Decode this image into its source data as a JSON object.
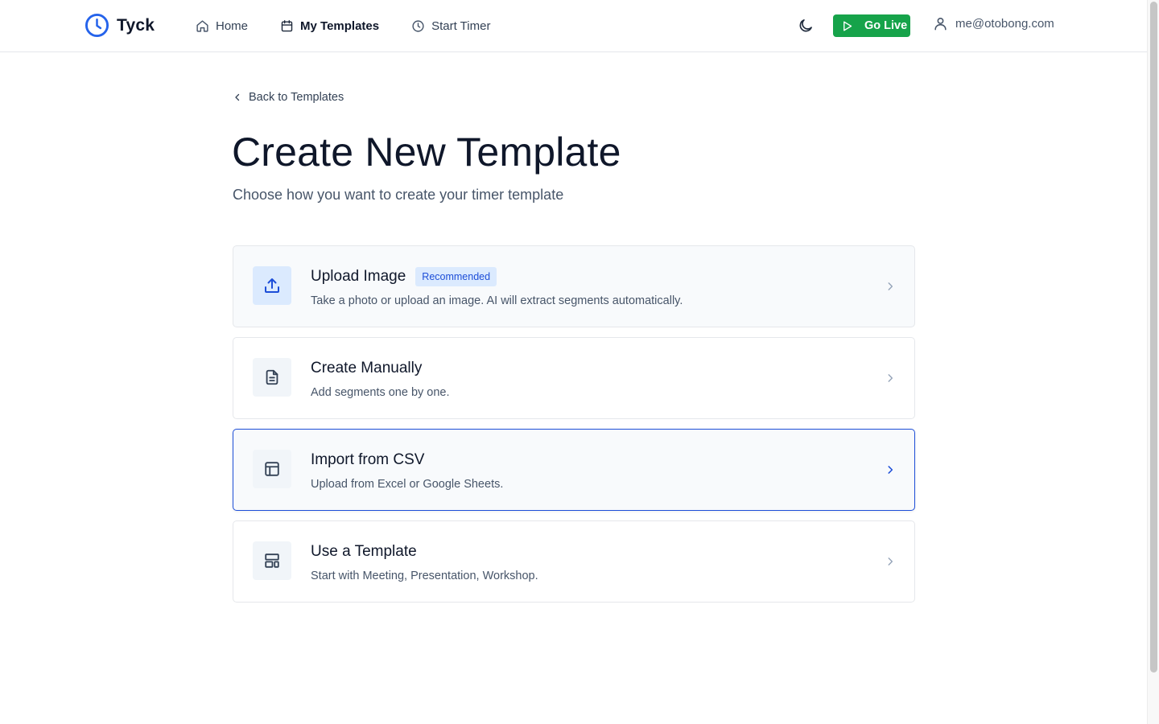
{
  "brand": {
    "name": "Tyck",
    "icon": "clock-icon",
    "accent": "#2563eb"
  },
  "nav": {
    "home": {
      "label": "Home",
      "icon": "home-icon"
    },
    "templates": {
      "label": "My Templates",
      "icon": "calendar-icon",
      "active": true
    },
    "timer": {
      "label": "Start Timer",
      "icon": "clock-icon"
    }
  },
  "header": {
    "theme_icon": "moon-icon",
    "go_live_label": "Go Live",
    "go_live_color": "#16a34a",
    "user_email": "me@otobong.com"
  },
  "page": {
    "back_label": "Back to Templates",
    "title": "Create New Template",
    "subtitle": "Choose how you want to create your timer template"
  },
  "options": [
    {
      "title": "Upload Image",
      "badge": "Recommended",
      "desc": "Take a photo or upload an image. AI will extract segments automatically.",
      "icon": "upload-icon"
    },
    {
      "title": "Create Manually",
      "desc": "Add segments one by one.",
      "icon": "document-icon"
    },
    {
      "title": "Import from CSV",
      "desc": "Upload from Excel or Google Sheets.",
      "icon": "table-icon",
      "selected": true
    },
    {
      "title": "Use a Template",
      "desc": "Start with Meeting, Presentation, Workshop.",
      "icon": "layout-icon"
    }
  ]
}
